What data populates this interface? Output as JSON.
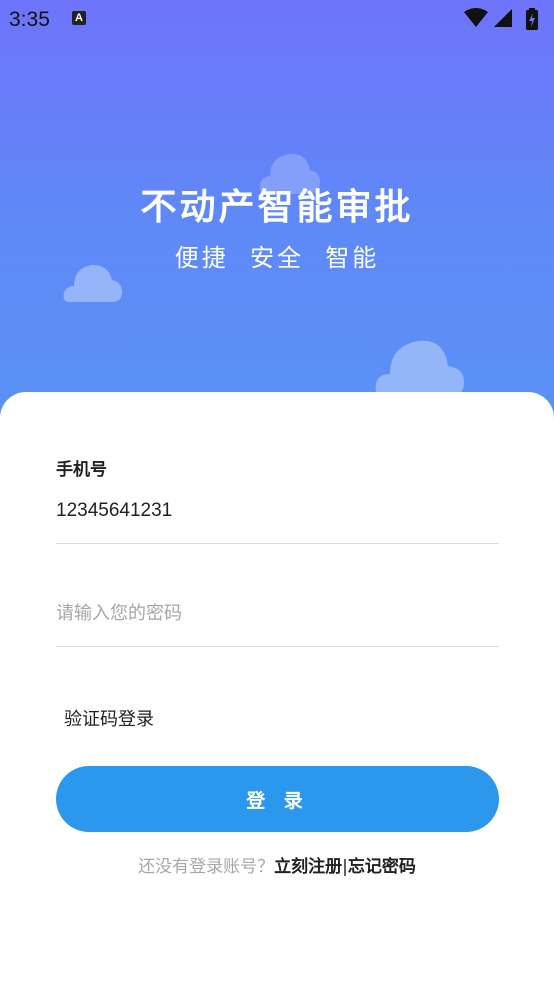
{
  "status_bar": {
    "time": "3:35",
    "notification_icon": "A",
    "icons": [
      "wifi-icon",
      "signal-icon",
      "battery-icon"
    ]
  },
  "hero": {
    "title": "不动产智能审批",
    "subtitle": "便捷  安全  智能",
    "gradient_colors": [
      "#6e74fb",
      "#5a92f5"
    ]
  },
  "form": {
    "phone_label": "手机号",
    "phone_value": "12345641231",
    "password_placeholder": "请输入您的密码",
    "sms_login_label": "验证码登录",
    "login_button_label": "登 录",
    "accent_color": "#2b98ee"
  },
  "footer": {
    "prompt": "还没有登录账号？",
    "register_label": "立刻注册",
    "separator": "|",
    "forgot_label": "忘记密码"
  }
}
